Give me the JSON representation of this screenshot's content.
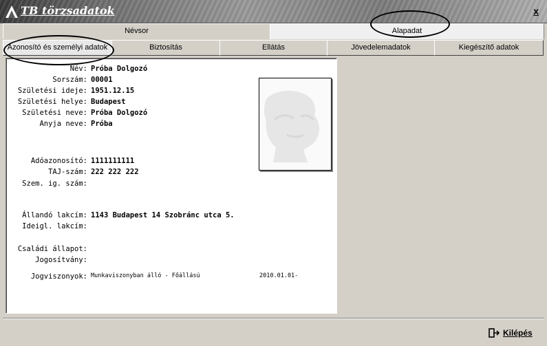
{
  "window": {
    "title": "TB törzsadatok",
    "close_label": "x"
  },
  "tabs_row1": [
    {
      "label": "Névsor",
      "active": false
    },
    {
      "label": "Alapadat",
      "active": true
    }
  ],
  "tabs_row2": [
    {
      "label": "Azonosító és személyi adatok",
      "active": true
    },
    {
      "label": "Biztosítás",
      "active": false
    },
    {
      "label": "Ellátás",
      "active": false
    },
    {
      "label": "Jövedelemadatok",
      "active": false
    },
    {
      "label": "Kiegészítő adatok",
      "active": false
    }
  ],
  "fields": {
    "nev": {
      "label": "Név:",
      "value": "Próba Dolgozó"
    },
    "sorszam": {
      "label": "Sorszám:",
      "value": "00001"
    },
    "szuletesi_ideje": {
      "label": "Születési ideje:",
      "value": "1951.12.15"
    },
    "szuletesi_helye": {
      "label": "Születési helye:",
      "value": "Budapest"
    },
    "szuletesi_neve": {
      "label": "Születési neve:",
      "value": "Próba Dolgozó"
    },
    "anyja_neve": {
      "label": "Anyja neve:",
      "value": "Próba"
    },
    "adoazonosito": {
      "label": "Adóazonosító:",
      "value": "1111111111"
    },
    "taj": {
      "label": "TAJ-szám:",
      "value": "222 222 222"
    },
    "szem_ig": {
      "label": "Szem. ig. szám:",
      "value": ""
    },
    "allando_lakcim": {
      "label": "Állandó lakcím:",
      "value": "1143 Budapest 14 Szobránc utca 5."
    },
    "ideigl_lakcim": {
      "label": "Ideigl. lakcím:",
      "value": ""
    },
    "csaladi_allapot": {
      "label": "Családi állapot:",
      "value": ""
    },
    "jogositvany": {
      "label": "Jogosítvány:",
      "value": ""
    },
    "jogviszonyok": {
      "label": "Jogviszonyok:",
      "value": "Munkaviszonyban álló - Főállású",
      "date": "2010.01.01-"
    }
  },
  "footer": {
    "exit_label": "Kilépés"
  }
}
